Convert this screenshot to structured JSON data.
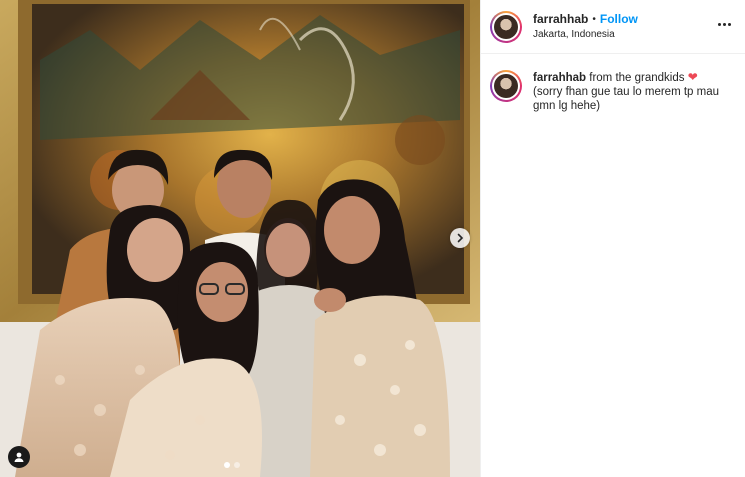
{
  "post": {
    "username": "farrahhab",
    "separator": "•",
    "follow_label": "Follow",
    "location": "Jakarta, Indonesia",
    "caption": {
      "username": "farrahhab",
      "text": "from the grandkids",
      "emoji": "❤",
      "text_line2": "(sorry fhan gue tau lo merem tp mau gmn lg hehe)"
    },
    "carousel": {
      "slides": 2,
      "active": 1
    }
  },
  "icons": {
    "next": "chevron-right-icon",
    "user_tag": "user-tag-icon",
    "more": "more-options-icon"
  },
  "colors": {
    "follow": "#0095f6",
    "heart": "#ed4956",
    "text": "#262626",
    "divider": "#efefef"
  }
}
